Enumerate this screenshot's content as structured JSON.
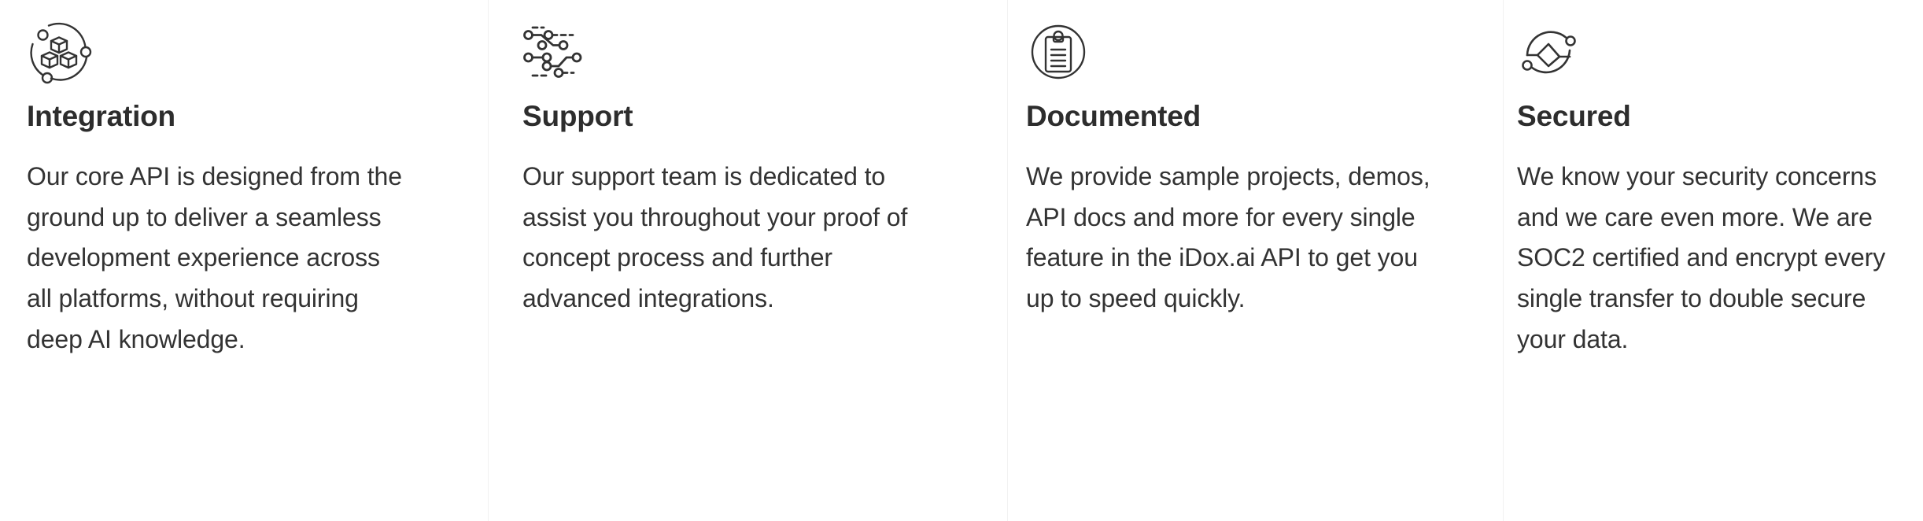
{
  "colors": {
    "background": "#ffffff",
    "heading": "#2d2d2d",
    "body": "#333333",
    "icon_stroke": "#333333",
    "divider": "#f1f1f1"
  },
  "features": [
    {
      "icon": "cubes-orbit-icon",
      "title": "Integration",
      "body": "Our core API is designed from the ground up to deliver a seamless development experience across all platforms, without requiring deep AI knowledge."
    },
    {
      "icon": "circuit-nodes-icon",
      "title": "Support",
      "body": "Our support team is dedicated to assist you throughout your proof of concept process and further advanced integrations."
    },
    {
      "icon": "clipboard-document-circle-icon",
      "title": "Documented",
      "body": "We provide sample projects, demos, API docs and more for every single feature in the iDox.ai API to get you up to speed quickly."
    },
    {
      "icon": "analytics-circle-chart-icon",
      "title": "Secured",
      "body": "We know your security concerns and we care even more. We are SOC2 certified and encrypt every single transfer to double secure your data."
    }
  ]
}
